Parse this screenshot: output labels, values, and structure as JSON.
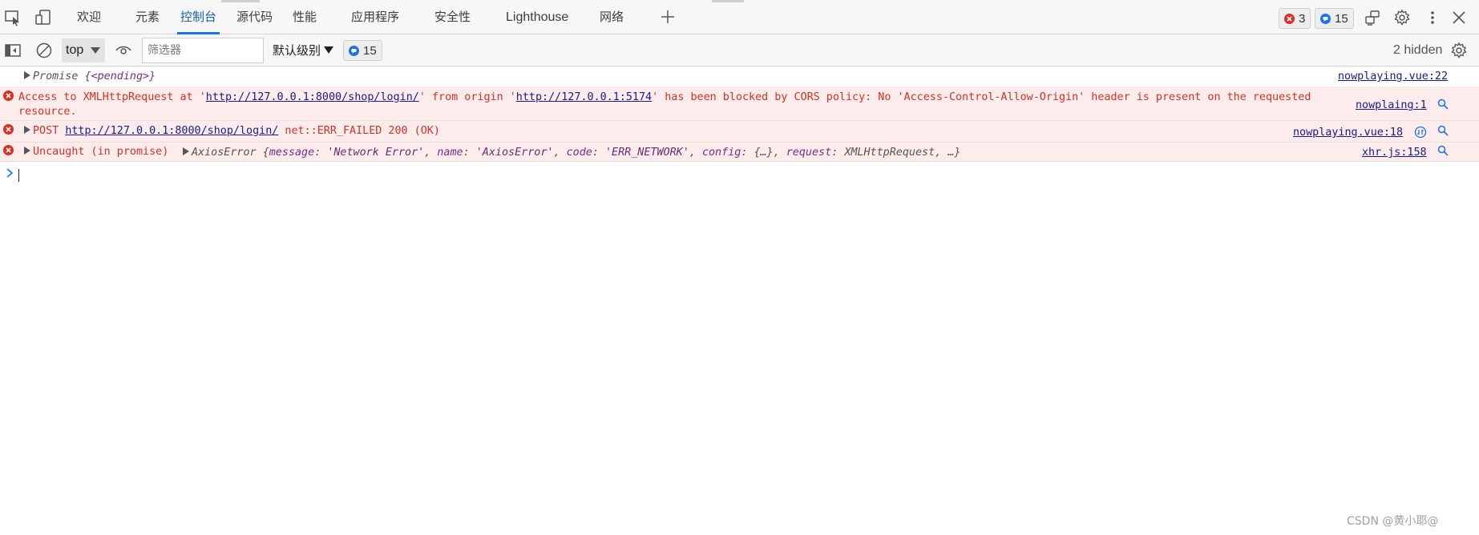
{
  "tabbar": {
    "tabs": [
      {
        "label": "欢迎"
      },
      {
        "label": "元素"
      },
      {
        "label": "控制台"
      },
      {
        "label": "源代码"
      },
      {
        "label": "性能"
      },
      {
        "label": "应用程序"
      },
      {
        "label": "安全性"
      },
      {
        "label": "Lighthouse"
      },
      {
        "label": "网络"
      }
    ],
    "active_tab": "控制台",
    "error_count": "3",
    "message_count": "15"
  },
  "toolbar": {
    "context": "top",
    "filter_placeholder": "筛选器",
    "level": "默认级别",
    "issues_count": "15",
    "hidden": "2 hidden"
  },
  "messages": [
    {
      "type": "log",
      "text_prefix": "Promise {",
      "text_key": "<pending>",
      "text_suffix": "}",
      "source": "nowplaying.vue:22"
    },
    {
      "type": "error",
      "line1_a": "Access to XMLHttpRequest at '",
      "url1": "http://127.0.0.1:8000/shop/login/",
      "line1_b": "' from origin '",
      "url2": "http://127.0.0.1:5174",
      "line1_c": "' has been blocked by CORS policy: No 'Access-Control-Allow-Origin' header is present on the requested",
      "line2": "resource.",
      "source": "nowplaing:1"
    },
    {
      "type": "error",
      "method": "POST",
      "url": "http://127.0.0.1:8000/shop/login/",
      "status": "net::ERR_FAILED 200 (OK)",
      "source": "nowplaying.vue:18"
    },
    {
      "type": "error",
      "prefix": "Uncaught (in promise)",
      "obj_name": "AxiosError",
      "obj_open": "{",
      "k1": "message",
      "v1": "'Network Error'",
      "k2": "name",
      "v2": "'AxiosError'",
      "k3": "code",
      "v3": "'ERR_NETWORK'",
      "k4": "config",
      "v4": "{…}",
      "k5": "request",
      "v5": "XMLHttpRequest",
      "obj_close": "…}",
      "source": "xhr.js:158"
    }
  ],
  "watermark": "CSDN @黄小耶@",
  "colors": {
    "error_red": "#d93025",
    "info_blue": "#1a73e8",
    "error_bg": "#fcecec",
    "link": "#1a1a8c"
  }
}
